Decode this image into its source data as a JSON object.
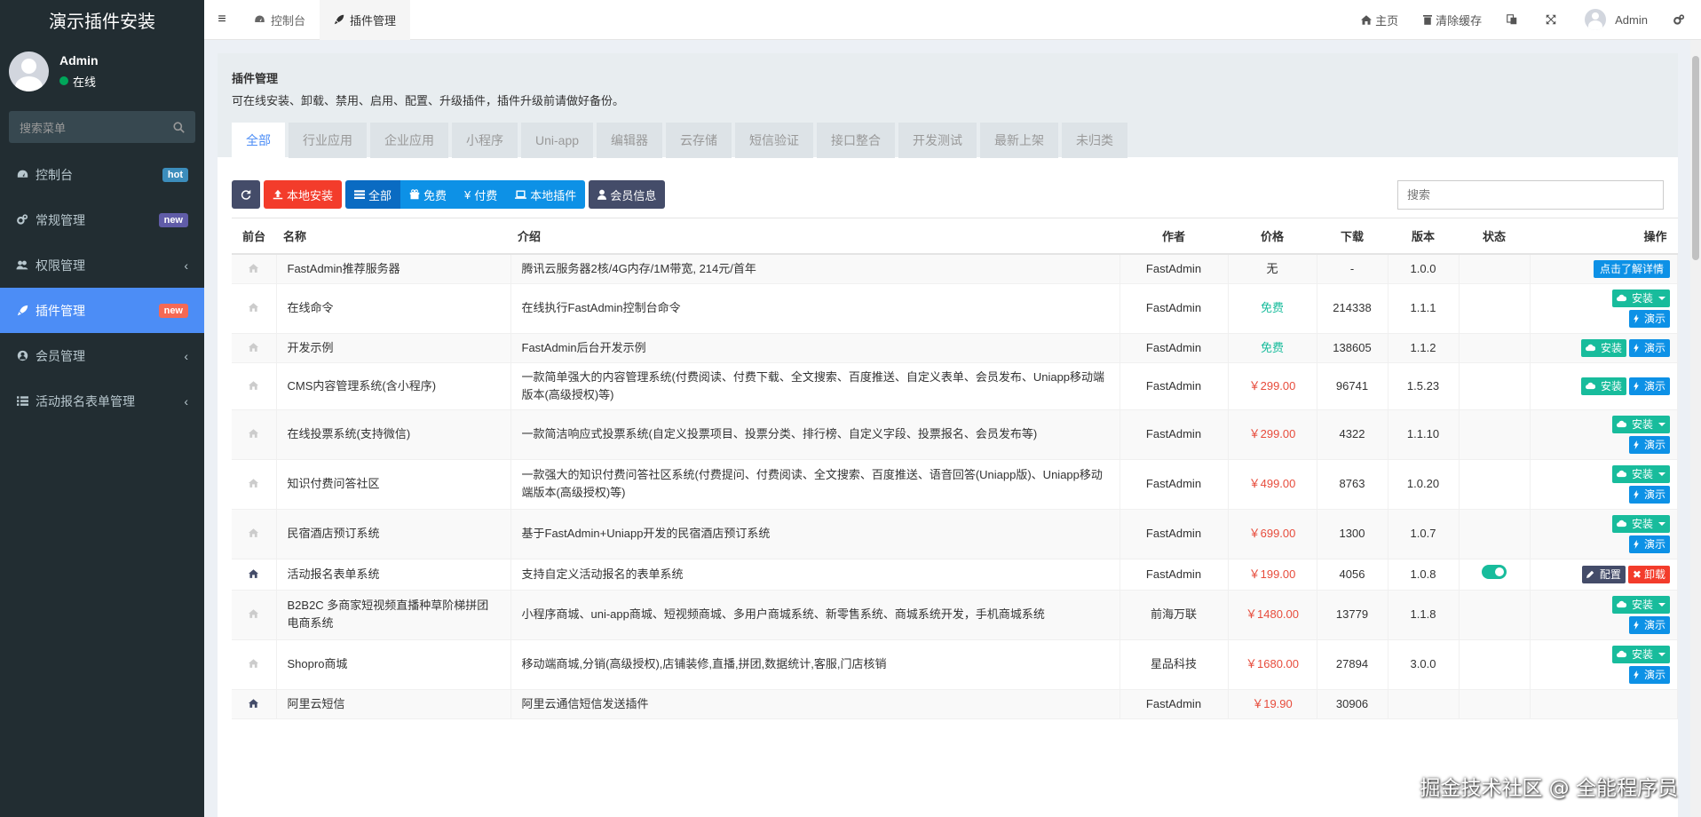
{
  "app": {
    "logo": "演示插件安装"
  },
  "user": {
    "name": "Admin",
    "status": "在线"
  },
  "sidebar": {
    "search_placeholder": "搜索菜单",
    "items": [
      {
        "label": "控制台",
        "icon": "dashboard-icon",
        "badge": "hot"
      },
      {
        "label": "常规管理",
        "icon": "cogs-icon",
        "badge": "new"
      },
      {
        "label": "权限管理",
        "icon": "group-icon",
        "chevron": "‹"
      },
      {
        "label": "插件管理",
        "icon": "rocket-icon",
        "badge": "new",
        "active": true
      },
      {
        "label": "会员管理",
        "icon": "user-circle-icon",
        "chevron": "‹"
      },
      {
        "label": "活动报名表单管理",
        "icon": "list-icon",
        "chevron": "‹"
      }
    ]
  },
  "topbar": {
    "tabs": [
      {
        "label": "控制台"
      },
      {
        "label": "插件管理"
      }
    ],
    "home": "主页",
    "clear_cache": "清除缓存",
    "username": "Admin"
  },
  "panel": {
    "title": "插件管理",
    "description": "可在线安装、卸载、禁用、启用、配置、升级插件，插件升级前请做好备份。",
    "categories": [
      "全部",
      "行业应用",
      "企业应用",
      "小程序",
      "Uni-app",
      "编辑器",
      "云存储",
      "短信验证",
      "接口整合",
      "开发测试",
      "最新上架",
      "未归类"
    ]
  },
  "toolbar": {
    "local_install": "本地安装",
    "filter_all": "全部",
    "filter_free": "免费",
    "filter_paid": "付费",
    "local_plugins": "本地插件",
    "member_info": "会员信息",
    "search_placeholder": "搜索"
  },
  "table": {
    "headers": [
      "前台",
      "名称",
      "介绍",
      "作者",
      "价格",
      "下载",
      "版本",
      "状态",
      "操作"
    ],
    "rows": [
      {
        "name": "FastAdmin推荐服务器",
        "intro": "腾讯云服务器2核/4G内存/1M带宽, 214元/首年",
        "author": "FastAdmin",
        "price": "无",
        "downloads": "-",
        "version": "1.0.0",
        "action": "detail"
      },
      {
        "name": "在线命令",
        "intro": "在线执行FastAdmin控制台命令",
        "author": "FastAdmin",
        "price": "免费",
        "downloads": "214338",
        "version": "1.1.1",
        "action": "stack"
      },
      {
        "name": "开发示例",
        "intro": "FastAdmin后台开发示例",
        "author": "FastAdmin",
        "price": "免费",
        "downloads": "138605",
        "version": "1.1.2",
        "action": "inline"
      },
      {
        "name": "CMS内容管理系统(含小程序)",
        "intro": "一款简单强大的内容管理系统(付费阅读、付费下载、全文搜索、百度推送、自定义表单、会员发布、Uniapp移动端版本(高级授权)等)",
        "author": "FastAdmin",
        "price": "￥299.00",
        "downloads": "96741",
        "version": "1.5.23",
        "action": "inline"
      },
      {
        "name": "在线投票系统(支持微信)",
        "intro": "一款简洁响应式投票系统(自定义投票项目、投票分类、排行榜、自定义字段、投票报名、会员发布等)",
        "author": "FastAdmin",
        "price": "￥299.00",
        "downloads": "4322",
        "version": "1.1.10",
        "action": "stack"
      },
      {
        "name": "知识付费问答社区",
        "intro": "一款强大的知识付费问答社区系统(付费提问、付费阅读、全文搜索、百度推送、语音回答(Uniapp版)、Uniapp移动端版本(高级授权)等)",
        "author": "FastAdmin",
        "price": "￥499.00",
        "downloads": "8763",
        "version": "1.0.20",
        "action": "stack"
      },
      {
        "name": "民宿酒店预订系统",
        "intro": "基于FastAdmin+Uniapp开发的民宿酒店预订系统",
        "author": "FastAdmin",
        "price": "￥699.00",
        "downloads": "1300",
        "version": "1.0.7",
        "action": "stack"
      },
      {
        "name": "活动报名表单系统",
        "intro": "支持自定义活动报名的表单系统",
        "author": "FastAdmin",
        "price": "￥199.00",
        "downloads": "4056",
        "version": "1.0.8",
        "action": "installed",
        "home_on": true
      },
      {
        "name": "B2B2C 多商家短视频直播种草阶梯拼团电商系统",
        "intro": "小程序商城、uni-app商城、短视频商城、多用户商城系统、新零售系统、商城系统开发，手机商城系统",
        "author": "前海万联",
        "price": "￥1480.00",
        "downloads": "13779",
        "version": "1.1.8",
        "action": "stack"
      },
      {
        "name": "Shopro商城",
        "intro": "移动端商城,分销(高级授权),店铺装修,直播,拼团,数据统计,客服,门店核销",
        "author": "星品科技",
        "price": "￥1680.00",
        "downloads": "27894",
        "version": "3.0.0",
        "action": "stack"
      },
      {
        "name": "阿里云短信",
        "intro": "阿里云通信短信发送插件",
        "author": "FastAdmin",
        "price": "￥19.90",
        "downloads": "30906",
        "version": "",
        "action": "none",
        "home_on": true
      }
    ],
    "labels": {
      "detail": "点击了解详情",
      "install": "安装",
      "demo": "演示",
      "config": "配置",
      "uninstall": "卸载"
    }
  },
  "watermark": "掘金技术社区 @ 全能程序员"
}
